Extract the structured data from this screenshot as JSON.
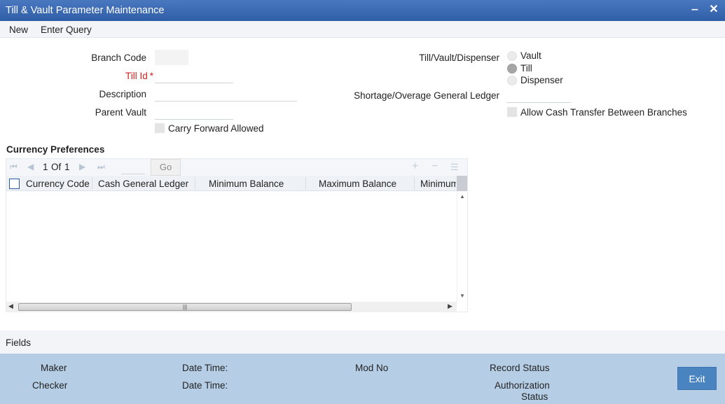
{
  "window": {
    "title": "Till & Vault Parameter Maintenance",
    "minimize": "‒",
    "close": "✕"
  },
  "menu": {
    "new": "New",
    "enter_query": "Enter Query"
  },
  "form": {
    "branch_code_label": "Branch Code",
    "till_id_label": "Till Id",
    "required_mark": "*",
    "description_label": "Description",
    "parent_vault_label": "Parent Vault",
    "carry_forward_label": "Carry Forward Allowed",
    "type_label": "Till/Vault/Dispenser",
    "type_options": [
      "Vault",
      "Till",
      "Dispenser"
    ],
    "type_selected": "Till",
    "shortage_gl_label": "Shortage/Overage General Ledger",
    "allow_cash_transfer_label": "Allow Cash Transfer Between Branches"
  },
  "currency": {
    "section_title": "Currency Preferences",
    "pager": {
      "current": "1",
      "of_label": "Of",
      "total": "1",
      "go": "Go"
    },
    "columns": [
      "Currency Code",
      "Cash General Ledger",
      "Minimum Balance",
      "Maximum Balance",
      "Minimum"
    ],
    "rows": []
  },
  "fields_bar": {
    "title": "Fields"
  },
  "footer": {
    "maker": "Maker",
    "checker": "Checker",
    "date_time_1": "Date Time:",
    "date_time_2": "Date Time:",
    "mod_no": "Mod No",
    "record_status": "Record Status",
    "authorization": "Authorization",
    "status": "Status",
    "exit": "Exit"
  },
  "colors": {
    "title_bar": "#3566b0",
    "footer": "#b5cee6",
    "required": "#d2211d",
    "exit_button": "#4a84c0"
  }
}
